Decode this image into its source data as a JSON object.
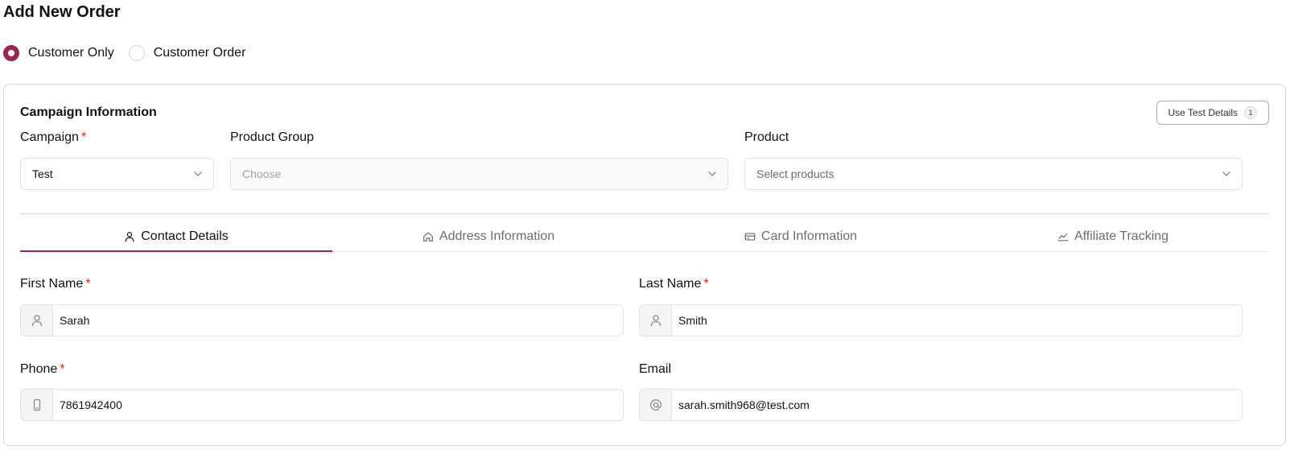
{
  "page": {
    "title": "Add New Order"
  },
  "order_type": {
    "options": [
      {
        "label": "Customer Only",
        "checked": true
      },
      {
        "label": "Customer Order",
        "checked": false
      }
    ]
  },
  "campaign_section": {
    "title": "Campaign Information",
    "test_button": {
      "label": "Use Test Details",
      "badge": "1"
    },
    "campaign": {
      "label": "Campaign",
      "required_mark": "*",
      "value": "Test"
    },
    "product_group": {
      "label": "Product Group",
      "placeholder": "Choose"
    },
    "product": {
      "label": "Product",
      "placeholder": "Select products"
    }
  },
  "tabs": [
    {
      "label": "Contact Details",
      "icon": "user-icon",
      "active": true
    },
    {
      "label": "Address Information",
      "icon": "home-icon",
      "active": false
    },
    {
      "label": "Card Information",
      "icon": "credit-card-icon",
      "active": false
    },
    {
      "label": "Affiliate Tracking",
      "icon": "chart-line-icon",
      "active": false
    }
  ],
  "contact": {
    "first_name": {
      "label": "First Name",
      "required_mark": "*",
      "value": "Sarah",
      "icon": "user-icon"
    },
    "last_name": {
      "label": "Last Name",
      "required_mark": "*",
      "value": "Smith",
      "icon": "user-icon"
    },
    "phone": {
      "label": "Phone",
      "required_mark": "*",
      "value": "7861942400",
      "icon": "phone-icon"
    },
    "email": {
      "label": "Email",
      "value": "sarah.smith968@test.com",
      "icon": "at-sign-icon"
    }
  },
  "colors": {
    "accent": "#9a2651",
    "required": "#dc2626",
    "border": "#e2e2e6"
  }
}
